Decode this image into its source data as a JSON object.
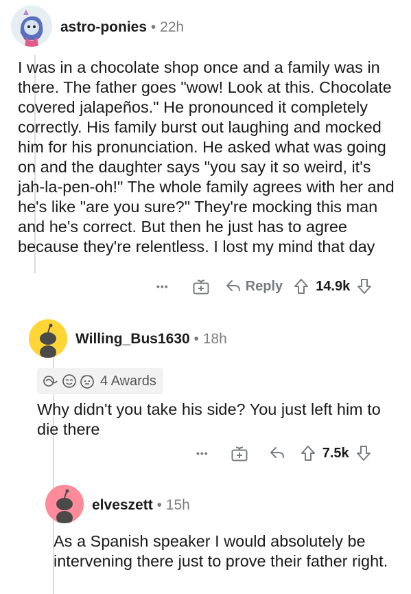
{
  "comments": [
    {
      "user": "astro-ponies",
      "time": "22h",
      "body": "I was in a chocolate shop once and a family was in there. The father goes \"wow! Look at this. Chocolate covered jalapeños.\" He pronounced it completely correctly. His family burst out laughing and mocked him for his pronunciation. He asked what was going on and the daughter says \"you say it so weird, it's jah-la-pen-oh!\" The whole family agrees with her and he's like \"are you sure?\" They're mocking this man and he's correct. But then he just has to agree because they're relentless. I lost my mind that day",
      "reply_label": "Reply",
      "score": "14.9k"
    },
    {
      "user": "Willing_Bus1630",
      "time": "18h",
      "awards_label": "4 Awards",
      "body": "Why didn't you take his side? You just left him to die there",
      "score": "7.5k"
    },
    {
      "user": "elveszett",
      "time": "15h",
      "body": "As a Spanish speaker I would absolutely be intervening there just to prove their father right."
    }
  ],
  "meta_separator": "•",
  "more_label": "•••",
  "colors": {
    "text": "#1a1a1b",
    "muted": "#787c7e",
    "snoo_yellow": "#ffd635",
    "snoo_pink": "#ff8b9a",
    "thread_line": "#dcdcdc"
  }
}
